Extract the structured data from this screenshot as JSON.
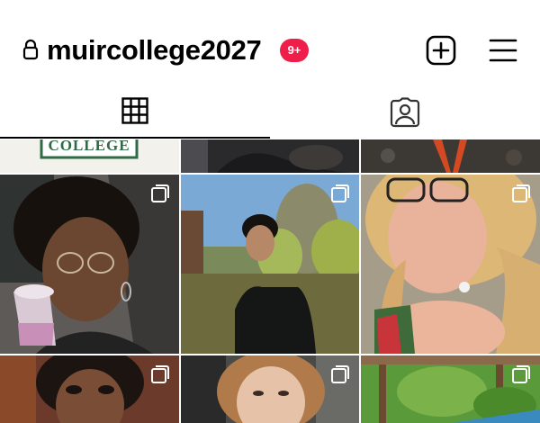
{
  "profile": {
    "username": "muircollege2027",
    "notification_badge": "9+",
    "lock_icon": "lock-icon",
    "badge_color": "#ef1d4a"
  },
  "header_actions": [
    {
      "icon": "add-post-icon"
    },
    {
      "icon": "hamburger-menu-icon"
    }
  ],
  "tabs": [
    {
      "icon": "grid-icon",
      "active": true
    },
    {
      "icon": "tagged-person-icon",
      "active": false
    }
  ],
  "banner_text": "COLLEGE",
  "grid": {
    "rows": 4,
    "columns": 3,
    "multi_photo_icon": "carousel-icon"
  }
}
